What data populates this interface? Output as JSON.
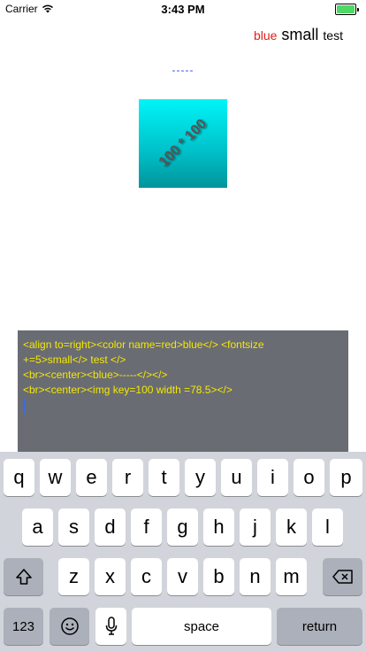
{
  "status_bar": {
    "carrier": "Carrier",
    "time": "3:43 PM",
    "battery_color": "#4cd964"
  },
  "preview": {
    "line1_red": "blue",
    "line1_small": "small",
    "line1_test": "test",
    "line2_blue": "-----",
    "image_label": "100 * 100"
  },
  "editor": {
    "lines": [
      "<align to=right><color name=red>blue</> <fontsize",
      "+=5>small</> test </>",
      "<br><center><blue>-----</></>",
      "<br><center><img key=100 width =78.5></>"
    ]
  },
  "keyboard": {
    "row1": [
      "q",
      "w",
      "e",
      "r",
      "t",
      "y",
      "u",
      "i",
      "o",
      "p"
    ],
    "row2": [
      "a",
      "s",
      "d",
      "f",
      "g",
      "h",
      "j",
      "k",
      "l"
    ],
    "row3": [
      "z",
      "x",
      "c",
      "v",
      "b",
      "n",
      "m"
    ],
    "shift_icon": "shift-icon",
    "delete_icon": "delete-icon",
    "numbers_label": "123",
    "emoji_icon": "emoji-icon",
    "mic_icon": "microphone-icon",
    "space_label": "space",
    "return_label": "return"
  }
}
